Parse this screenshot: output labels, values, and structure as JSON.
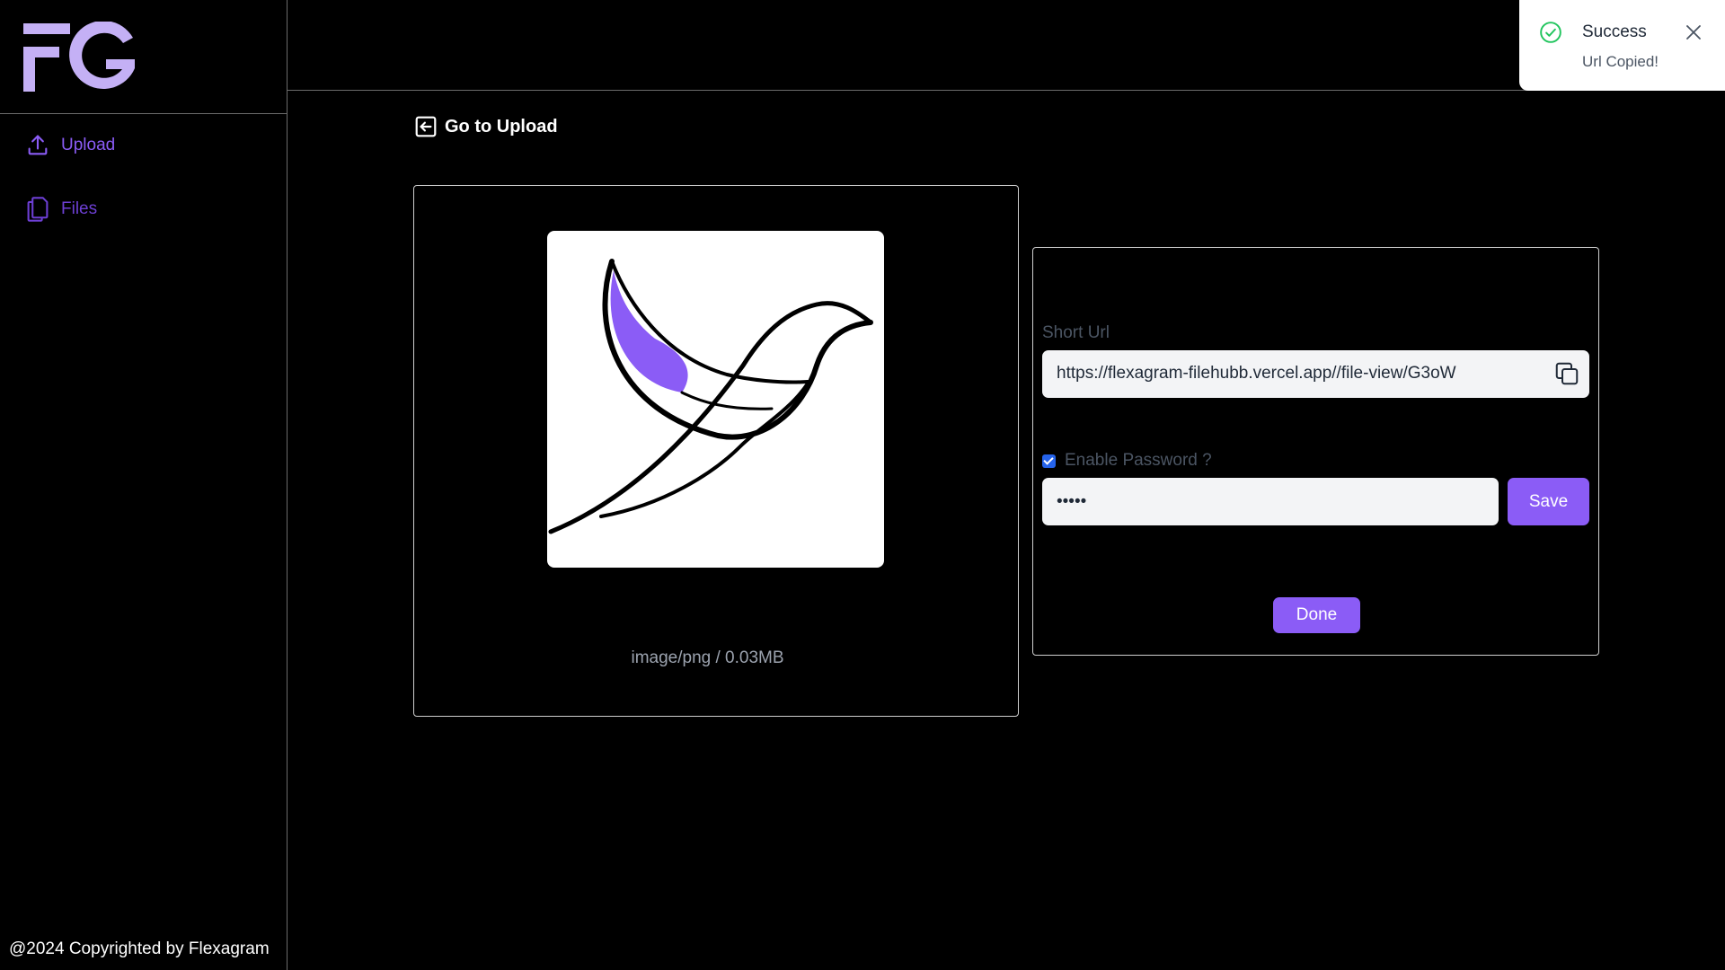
{
  "sidebar": {
    "logo_text": "FG",
    "items": [
      {
        "label": "Upload",
        "icon": "upload-icon"
      },
      {
        "label": "Files",
        "icon": "files-icon"
      }
    ],
    "footer": "@2024 Copyrighted by Flexagram"
  },
  "main": {
    "back_label": "Go to Upload",
    "file_meta": "image/png / 0.03MB",
    "short_url_label": "Short Url",
    "short_url": "https://flexagram-filehubb.vercel.app//file-view/G3oW",
    "enable_password_label": "Enable Password ?",
    "password_enabled": true,
    "password_value": "•••••",
    "save_label": "Save",
    "done_label": "Done"
  },
  "toast": {
    "title": "Success",
    "message": "Url Copied!"
  },
  "colors": {
    "accent": "#8b5cf6",
    "background": "#000000",
    "success": "#22c55e"
  }
}
